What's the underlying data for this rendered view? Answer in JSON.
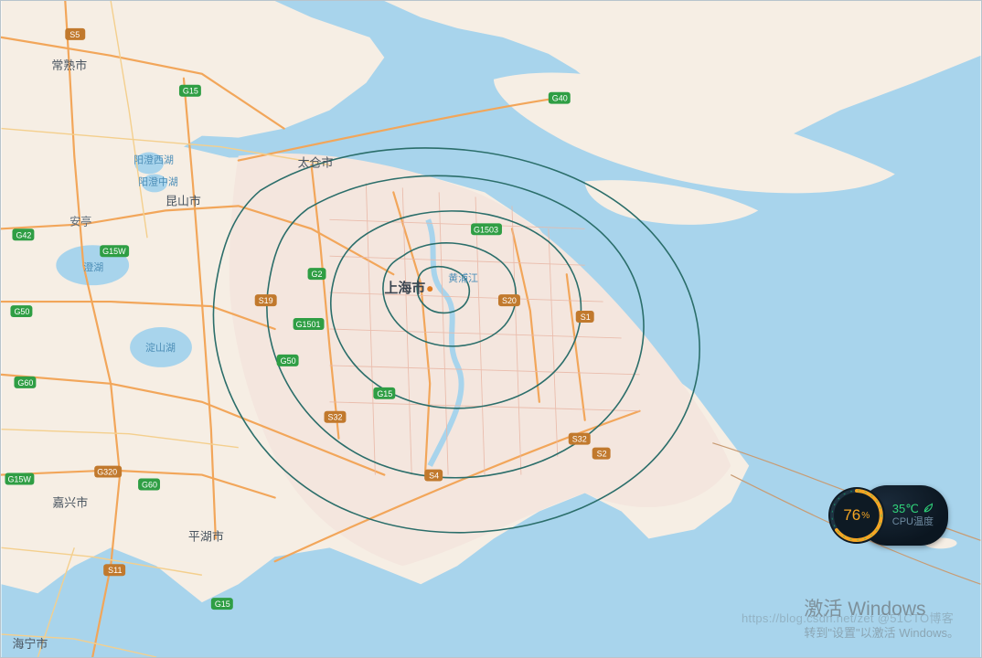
{
  "map": {
    "center_label": "上海市",
    "river_label": "黄浦江",
    "cities": {
      "changshu": "常熟市",
      "taicang": "太仓市",
      "kunshan": "昆山市",
      "jiaxing": "嘉兴市",
      "pinghu": "平湖市",
      "haining": "海宁市",
      "anting": "安亭"
    },
    "lakes": {
      "yangcheng_w": "阳澄西湖",
      "yangcheng_m": "阳澄中湖",
      "cheng": "澄湖",
      "dianshan": "淀山湖"
    },
    "highways": {
      "s5": "S5",
      "g15_a": "G15",
      "g15_b": "G15",
      "g15_c": "G15",
      "g15w_a": "G15W",
      "g15w_b": "G15W",
      "g1501": "G1501",
      "g40": "G40",
      "g2": "G2",
      "g42": "G42",
      "g50_a": "G50",
      "g50_b": "G50",
      "g60_a": "G60",
      "g60_b": "G60",
      "g320": "G320",
      "g1503": "G1503",
      "s11": "S11",
      "s19": "S19",
      "s20": "S20",
      "s32_a": "S32",
      "s32_b": "S32",
      "s2": "S2",
      "s4": "S4",
      "s1": "S1"
    }
  },
  "system_widget": {
    "percent": "76",
    "percent_suffix": "%",
    "temp": "35℃",
    "temp_label": "CPU温度"
  },
  "watermarks": {
    "activate_line1": "激活 Windows",
    "activate_line2": "转到\"设置\"以激活 Windows。",
    "blog": "https://blog.csdn.net/zet @51CTO博客"
  }
}
